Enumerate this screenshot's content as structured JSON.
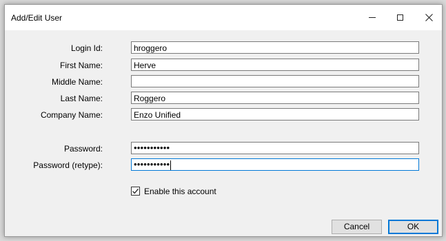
{
  "window": {
    "title": "Add/Edit User"
  },
  "form": {
    "fields": [
      {
        "label": "Login Id:",
        "value": "hroggero"
      },
      {
        "label": "First Name:",
        "value": "Herve"
      },
      {
        "label": "Middle Name:",
        "value": ""
      },
      {
        "label": "Last Name:",
        "value": "Roggero"
      },
      {
        "label": "Company Name:",
        "value": "Enzo Unified"
      }
    ],
    "password": {
      "label": "Password:",
      "masked_value": "•••••••••••"
    },
    "password_retype": {
      "label": "Password (retype):",
      "masked_value": "•••••••••••"
    },
    "enable_account": {
      "label": "Enable this account",
      "checked": true
    }
  },
  "buttons": {
    "cancel": "Cancel",
    "ok": "OK"
  },
  "icons": {
    "minimize": "minimize-icon",
    "maximize": "maximize-icon",
    "close": "close-icon",
    "check": "checkmark-icon"
  },
  "colors": {
    "focus_border": "#0078d7",
    "dialog_bg": "#f0f0f0"
  }
}
